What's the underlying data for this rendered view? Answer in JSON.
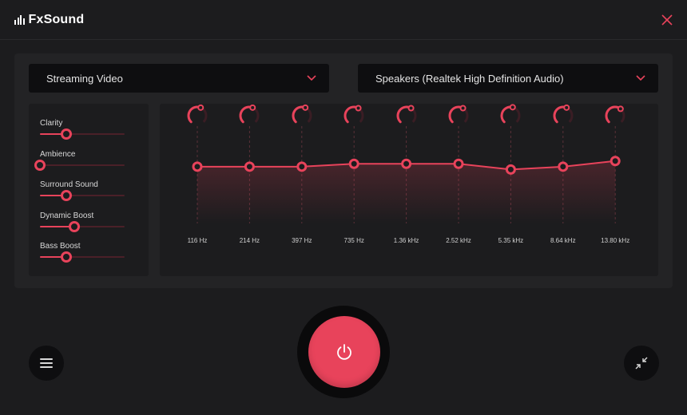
{
  "app": {
    "name": "FxSound"
  },
  "colors": {
    "accent": "#e8435b",
    "background": "#1c1c1e",
    "panel": "#232325",
    "control": "#0e0e10"
  },
  "icons": {
    "logo": "equalizer-bars-icon",
    "close": "close-x-icon",
    "dropdown": "chevron-down-icon",
    "menu": "hamburger-menu-icon",
    "power": "power-icon",
    "minimize": "compress-arrows-icon"
  },
  "preset": {
    "selected": "Streaming Video"
  },
  "output_device": {
    "selected": "Speakers (Realtek High Definition Audio)"
  },
  "effects": [
    {
      "label": "Clarity",
      "value": 0.31
    },
    {
      "label": "Ambience",
      "value": 0.0
    },
    {
      "label": "Surround Sound",
      "value": 0.31
    },
    {
      "label": "Dynamic Boost",
      "value": 0.41
    },
    {
      "label": "Bass Boost",
      "value": 0.31
    }
  ],
  "equalizer": {
    "gain_range": [
      -12,
      12
    ],
    "bands": [
      {
        "label": "116 Hz",
        "gain": 2
      },
      {
        "label": "214 Hz",
        "gain": 2
      },
      {
        "label": "397 Hz",
        "gain": 2
      },
      {
        "label": "735 Hz",
        "gain": 2.7
      },
      {
        "label": "1.36 kHz",
        "gain": 2.7
      },
      {
        "label": "2.52 kHz",
        "gain": 2.7
      },
      {
        "label": "5.35 kHz",
        "gain": 1.3
      },
      {
        "label": "8.64 kHz",
        "gain": 2
      },
      {
        "label": "13.80 kHz",
        "gain": 3.4
      }
    ]
  },
  "power": {
    "on": true
  }
}
